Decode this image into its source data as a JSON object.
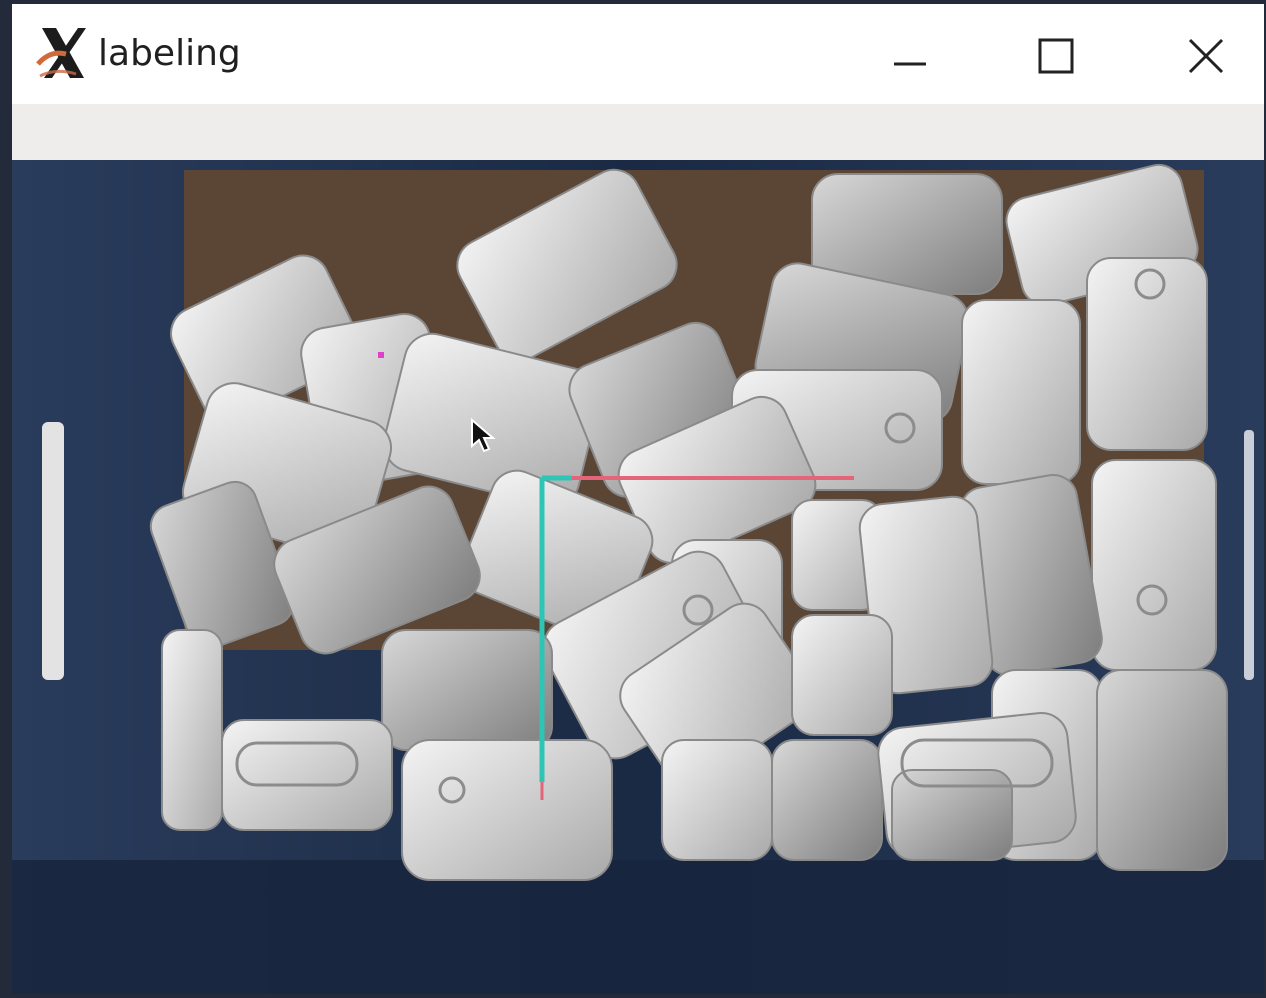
{
  "window": {
    "title": "labeling",
    "app_icon": "x-logo-icon",
    "controls": [
      "minimize-icon",
      "maximize-icon",
      "close-icon"
    ]
  },
  "canvas": {
    "cursor_icon": "mouse-pointer-icon",
    "annotation_colors": {
      "horizontal_line": "#e4657a",
      "vertical_line": "#2ec4b6",
      "marker": "#e040c8"
    }
  },
  "colors": {
    "bin_blue": "#1d2d48",
    "cardboard": "#5b4636",
    "tin_light": "#e6e6e6",
    "tin_mid": "#bdbdbd"
  }
}
